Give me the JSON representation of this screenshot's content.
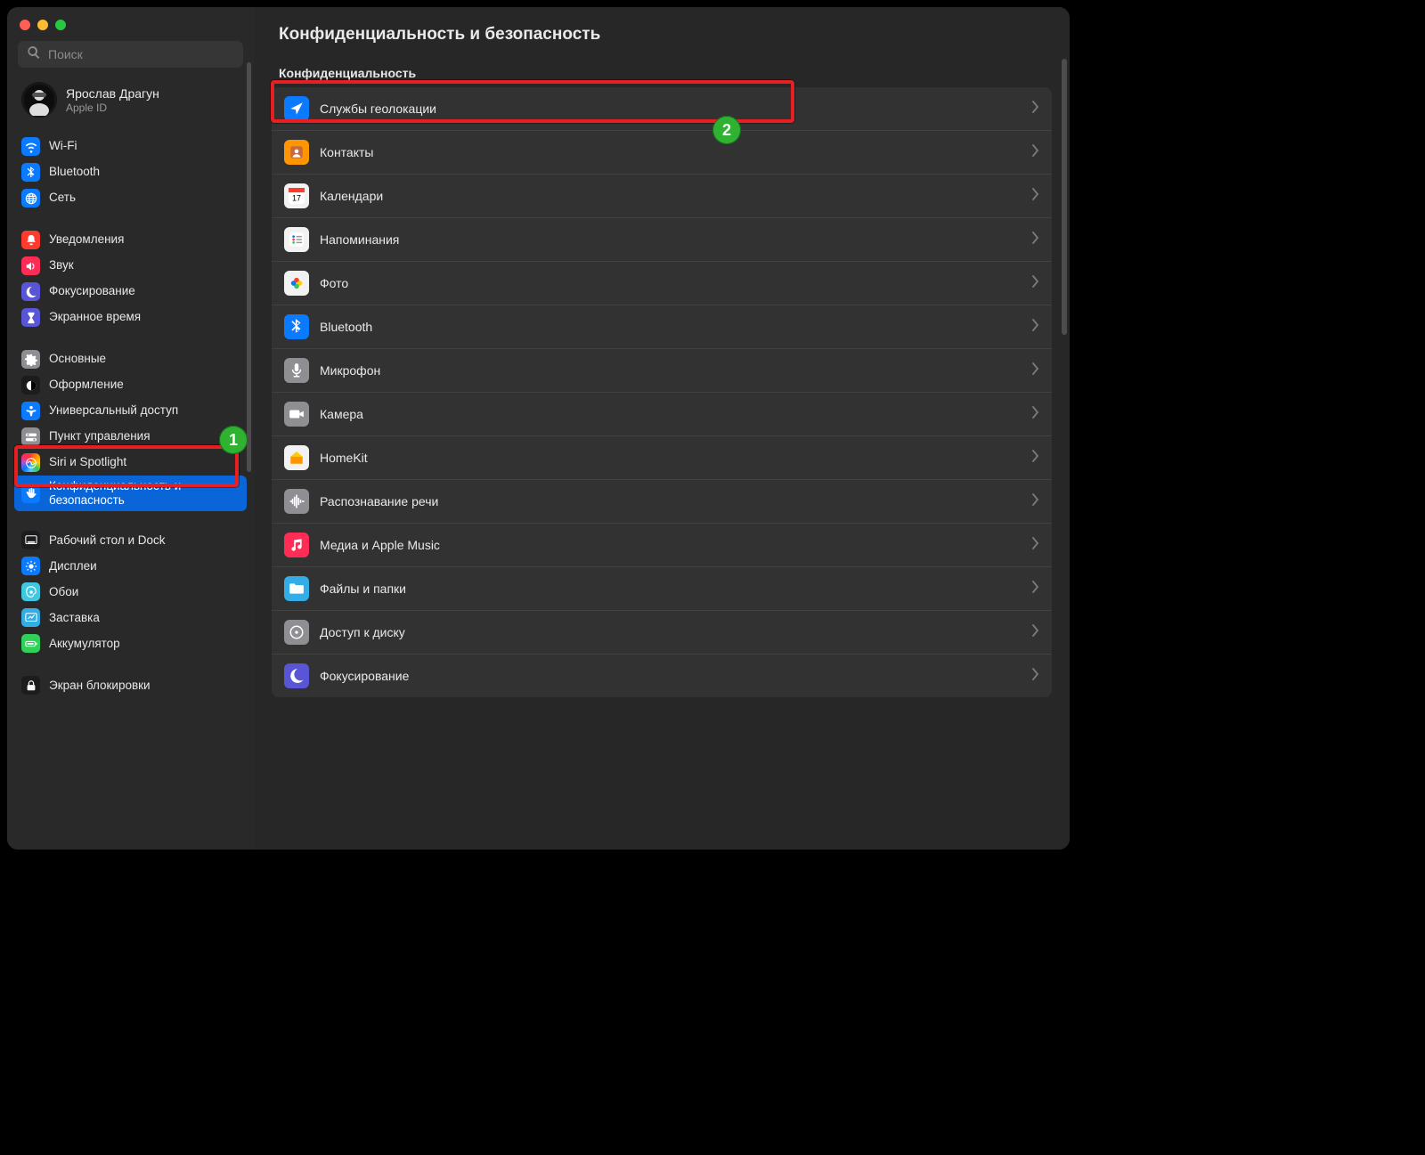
{
  "search": {
    "placeholder": "Поиск"
  },
  "account": {
    "name": "Ярослав Драгун",
    "sub": "Apple ID"
  },
  "sidebar": {
    "groups": [
      [
        {
          "label": "Wi-Fi",
          "icon": "wifi",
          "bg": "bg-blue"
        },
        {
          "label": "Bluetooth",
          "icon": "bluetooth",
          "bg": "bg-blue"
        },
        {
          "label": "Сеть",
          "icon": "globe",
          "bg": "bg-blue"
        }
      ],
      [
        {
          "label": "Уведомления",
          "icon": "bell",
          "bg": "bg-red"
        },
        {
          "label": "Звук",
          "icon": "speaker",
          "bg": "bg-pink"
        },
        {
          "label": "Фокусирование",
          "icon": "moon",
          "bg": "bg-purple"
        },
        {
          "label": "Экранное время",
          "icon": "hourglass",
          "bg": "bg-purple"
        }
      ],
      [
        {
          "label": "Основные",
          "icon": "gear",
          "bg": "bg-grey"
        },
        {
          "label": "Оформление",
          "icon": "appearance",
          "bg": "bg-black"
        },
        {
          "label": "Универсальный доступ",
          "icon": "accessibility",
          "bg": "bg-blue"
        },
        {
          "label": "Пункт управления",
          "icon": "switches",
          "bg": "bg-grey"
        },
        {
          "label": "Siri и Spotlight",
          "icon": "siri",
          "bg": "bg-gradient"
        },
        {
          "label": "Конфиденциальность и безопасность",
          "icon": "hand",
          "bg": "bg-blue",
          "selected": true
        }
      ],
      [
        {
          "label": "Рабочий стол и Dock",
          "icon": "dock",
          "bg": "bg-black"
        },
        {
          "label": "Дисплеи",
          "icon": "display",
          "bg": "bg-blue"
        },
        {
          "label": "Обои",
          "icon": "wallpaper",
          "bg": "bg-cyan"
        },
        {
          "label": "Заставка",
          "icon": "screensaver",
          "bg": "bg-teal"
        },
        {
          "label": "Аккумулятор",
          "icon": "battery",
          "bg": "bg-green"
        }
      ],
      [
        {
          "label": "Экран блокировки",
          "icon": "lock",
          "bg": "bg-black"
        }
      ]
    ]
  },
  "main": {
    "title": "Конфиденциальность и безопасность",
    "section": "Конфиденциальность",
    "rows": [
      {
        "label": "Службы геолокации",
        "icon": "location",
        "bg": "bg-blue"
      },
      {
        "label": "Контакты",
        "icon": "contacts",
        "bg": "bg-orange"
      },
      {
        "label": "Календари",
        "icon": "calendar",
        "bg": "bg-white"
      },
      {
        "label": "Напоминания",
        "icon": "reminders",
        "bg": "bg-white"
      },
      {
        "label": "Фото",
        "icon": "photos",
        "bg": "bg-white"
      },
      {
        "label": "Bluetooth",
        "icon": "bluetooth",
        "bg": "bg-blue"
      },
      {
        "label": "Микрофон",
        "icon": "mic",
        "bg": "bg-grey"
      },
      {
        "label": "Камера",
        "icon": "camera",
        "bg": "bg-grey"
      },
      {
        "label": "HomeKit",
        "icon": "home",
        "bg": "bg-white"
      },
      {
        "label": "Распознавание речи",
        "icon": "waveform",
        "bg": "bg-grey"
      },
      {
        "label": "Медиа и Apple Music",
        "icon": "music",
        "bg": "bg-pink"
      },
      {
        "label": "Файлы и папки",
        "icon": "folder",
        "bg": "bg-teal"
      },
      {
        "label": "Доступ к диску",
        "icon": "disk",
        "bg": "bg-grey"
      },
      {
        "label": "Фокусирование",
        "icon": "moon",
        "bg": "bg-purple"
      }
    ]
  },
  "annotations": {
    "badge1": "1",
    "badge2": "2",
    "calendar_day": "17"
  }
}
